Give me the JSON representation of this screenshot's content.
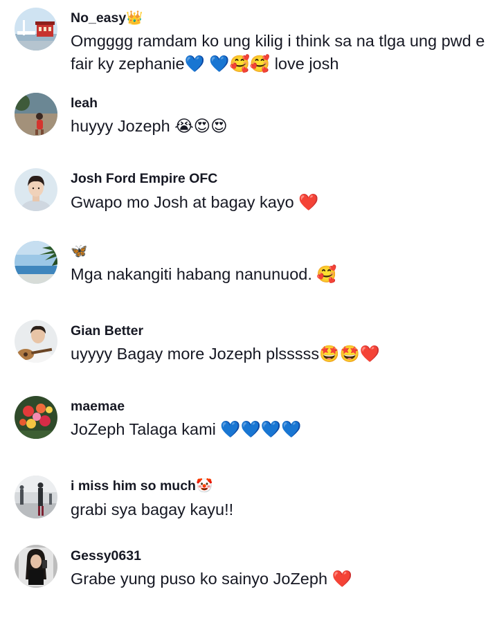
{
  "comments": [
    {
      "username": "No_easy👑",
      "text": "Omgggg ramdam ko ung kilig i think sa na tlga ung pwd e fair ky zephanie💙 💙🥰🥰 love josh",
      "avatar": "amusement-park-avatar"
    },
    {
      "username": "leah",
      "text": "huyyy Jozeph 😭😍😍",
      "avatar": "beach-person-avatar"
    },
    {
      "username": "Josh Ford Empire OFC",
      "text": "Gwapo mo Josh at bagay kayo ❤️",
      "avatar": "young-man-avatar"
    },
    {
      "username": "🦋",
      "text": "Mga nakangiti habang nanunuod. 🥰",
      "avatar": "palm-beach-avatar"
    },
    {
      "username": "Gian Better",
      "text": "uyyyy Bagay more Jozeph plsssss🤩🤩❤️",
      "avatar": "guitar-player-avatar"
    },
    {
      "username": "maemae",
      "text": "JoZeph Talaga kami 💙💙💙💙",
      "avatar": "flower-bouquet-avatar"
    },
    {
      "username": "i miss him so much🤡",
      "text": "grabi sya bagay kayu!!",
      "avatar": "street-scene-avatar"
    },
    {
      "username": "Gessy0631",
      "text": "Grabe yung puso ko sainyo JoZeph ❤️",
      "avatar": "mirror-selfie-avatar"
    }
  ]
}
